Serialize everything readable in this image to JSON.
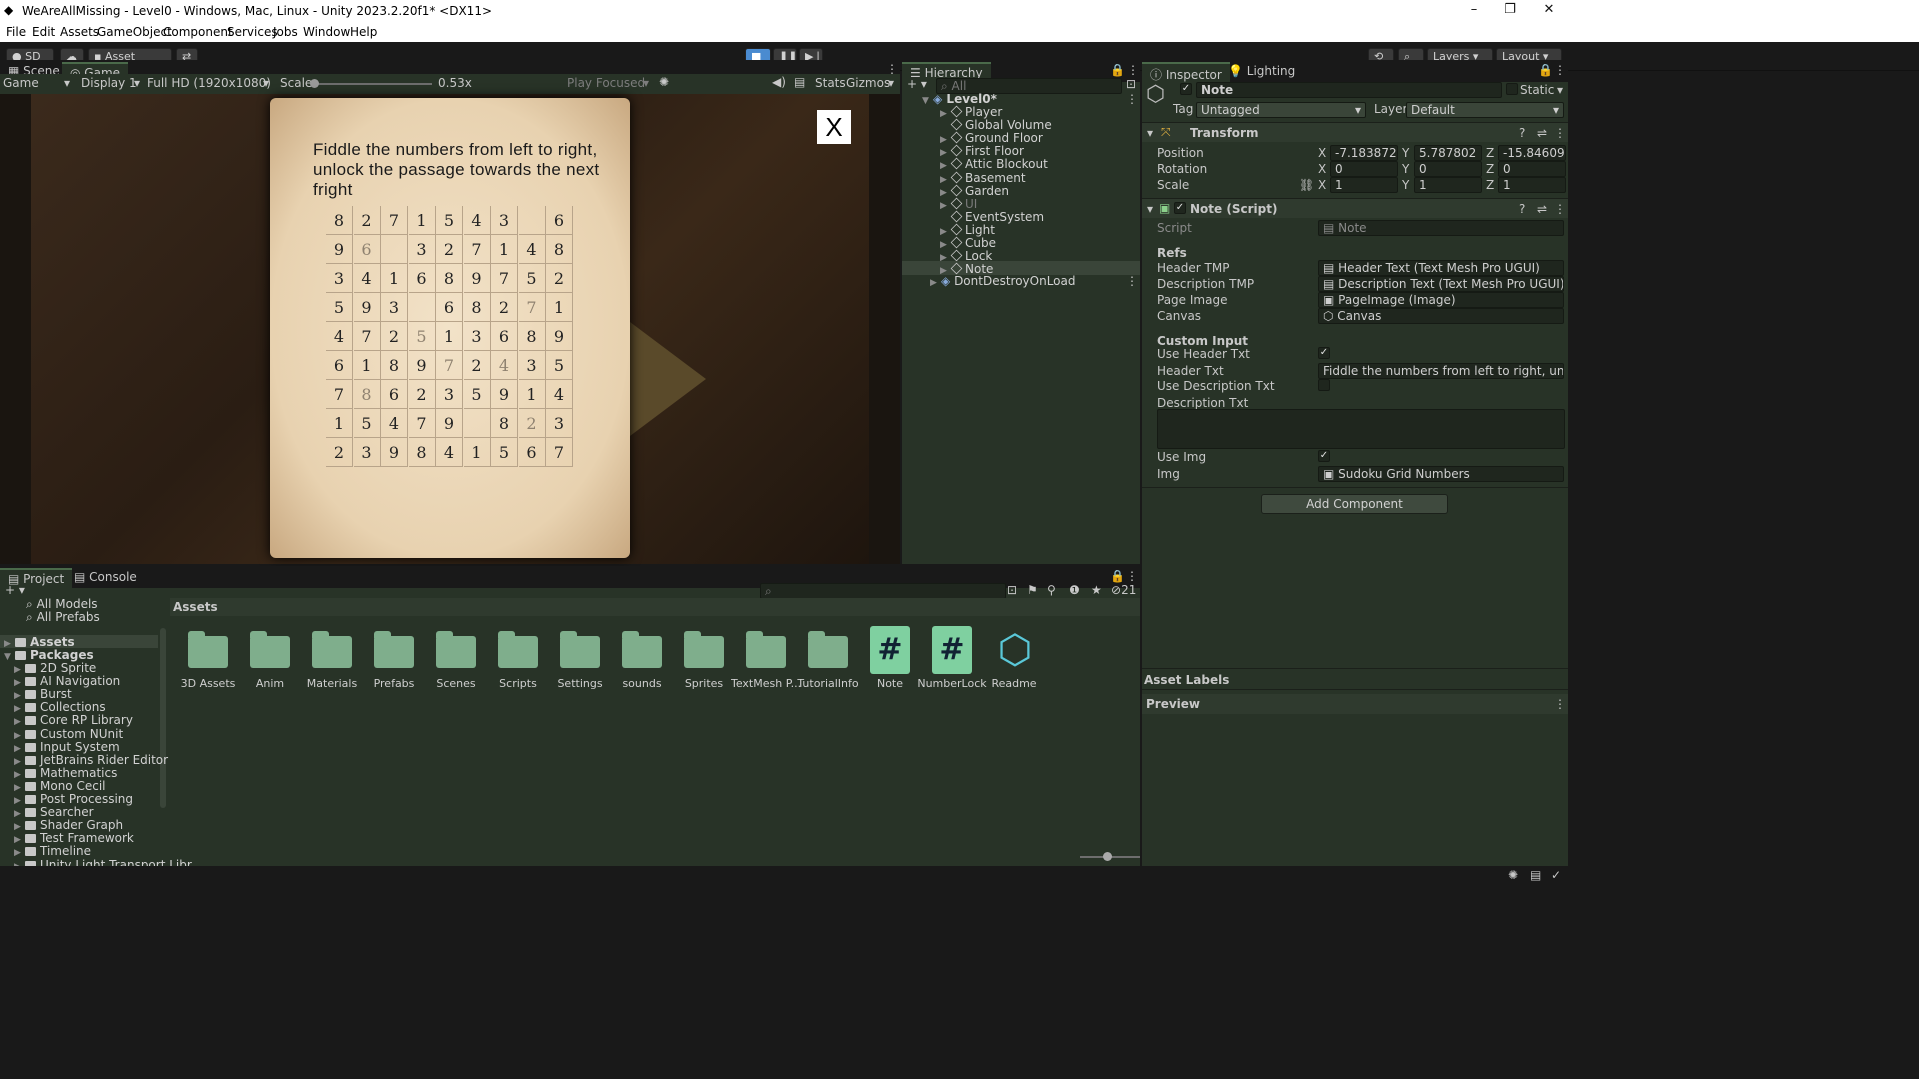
{
  "window": {
    "title": "WeAreAllMissing - Level0 - Windows, Mac, Linux - Unity 2023.2.20f1* <DX11>",
    "controls": [
      "–",
      "❐",
      "✕"
    ]
  },
  "menu": [
    "File",
    "Edit",
    "Assets",
    "GameObject",
    "Component",
    "Services",
    "Jobs",
    "Window",
    "Help"
  ],
  "toolbar": {
    "account": "SD",
    "asset_store": "Asset Store",
    "layers": "Layers",
    "layout": "Layout"
  },
  "scene_tabs": {
    "scene": "Scene",
    "game": "Game"
  },
  "game_bar": {
    "mode": "Game",
    "display": "Display 1",
    "resolution": "Full HD (1920x1080)",
    "scale_label": "Scale",
    "scale_value": "0.53x",
    "play_focused": "Play Focused",
    "stats": "Stats",
    "gizmos": "Gizmos"
  },
  "game_view": {
    "note_text": "Fiddle the numbers from left to right, unlock the passage towards the next fright",
    "close_label": "X",
    "grid": [
      [
        "8",
        "2",
        "7",
        "1",
        "5",
        "4",
        "3",
        "",
        "6"
      ],
      [
        "9",
        "6",
        "",
        "3",
        "2",
        "7",
        "1",
        "4",
        "8"
      ],
      [
        "3",
        "4",
        "1",
        "6",
        "8",
        "9",
        "7",
        "5",
        "2"
      ],
      [
        "5",
        "9",
        "3",
        "",
        "6",
        "8",
        "2",
        "7",
        "1"
      ],
      [
        "4",
        "7",
        "2",
        "5",
        "1",
        "3",
        "6",
        "8",
        "9"
      ],
      [
        "6",
        "1",
        "8",
        "9",
        "7",
        "2",
        "4",
        "3",
        "5"
      ],
      [
        "7",
        "8",
        "6",
        "2",
        "3",
        "5",
        "9",
        "1",
        "4"
      ],
      [
        "1",
        "5",
        "4",
        "7",
        "9",
        "",
        "8",
        "2",
        "3"
      ],
      [
        "2",
        "3",
        "9",
        "8",
        "4",
        "1",
        "5",
        "6",
        "7"
      ]
    ],
    "light_cells": [
      "1-1",
      "3-7",
      "4-3",
      "5-4",
      "5-6",
      "6-1",
      "7-7"
    ]
  },
  "hierarchy": {
    "tab": "Hierarchy",
    "search_placeholder": "All",
    "scene": "Level0*",
    "items": [
      "Player",
      "Global Volume",
      "Ground Floor",
      "First Floor",
      "Attic Blockout",
      "Basement",
      "Garden",
      "UI",
      "EventSystem",
      "Light",
      "Cube",
      "Lock",
      "Note"
    ],
    "dont_destroy": "DontDestroyOnLoad"
  },
  "inspector": {
    "tab": "Inspector",
    "lighting_tab": "Lighting",
    "object_name": "Note",
    "static_label": "Static",
    "tag_label": "Tag",
    "tag_value": "Untagged",
    "layer_label": "Layer",
    "layer_value": "Default",
    "transform": {
      "title": "Transform",
      "position_label": "Position",
      "rotation_label": "Rotation",
      "scale_label": "Scale",
      "position": {
        "x": "-7.183872",
        "y": "5.787802",
        "z": "-15.84609"
      },
      "rotation": {
        "x": "0",
        "y": "0",
        "z": "0"
      },
      "scale": {
        "x": "1",
        "y": "1",
        "z": "1"
      }
    },
    "script_comp": {
      "title": "Note (Script)",
      "script_label": "Script",
      "script_value": "Note",
      "refs_header": "Refs",
      "header_tmp_label": "Header TMP",
      "header_tmp_value": "Header Text (Text Mesh Pro UGUI)",
      "desc_tmp_label": "Description TMP",
      "desc_tmp_value": "Description Text (Text Mesh Pro UGUI)",
      "page_image_label": "Page Image",
      "page_image_value": "PageImage (Image)",
      "canvas_label": "Canvas",
      "canvas_value": "Canvas",
      "custom_header": "Custom Input",
      "use_header_label": "Use Header Txt",
      "header_txt_label": "Header Txt",
      "header_txt_value": "Fiddle the numbers from left to right, unlock the pas",
      "use_desc_label": "Use Description Txt",
      "desc_txt_label": "Description Txt",
      "use_img_label": "Use Img",
      "img_label": "Img",
      "img_value": "Sudoku Grid Numbers"
    },
    "add_component": "Add Component",
    "asset_labels": "Asset Labels",
    "preview": "Preview"
  },
  "project": {
    "tab": "Project",
    "console_tab": "Console",
    "hidden_count": "21",
    "breadcrumb": "Assets",
    "favorites": [
      "All Models",
      "All Prefabs"
    ],
    "assets_root": "Assets",
    "packages_root": "Packages",
    "packages": [
      "2D Sprite",
      "AI Navigation",
      "Burst",
      "Collections",
      "Core RP Library",
      "Custom NUnit",
      "Input System",
      "JetBrains Rider Editor",
      "Mathematics",
      "Mono Cecil",
      "Post Processing",
      "Searcher",
      "Shader Graph",
      "Test Framework",
      "Timeline",
      "Unity Light Transport Libr..."
    ],
    "assets": [
      {
        "name": "3D Assets",
        "kind": "folder"
      },
      {
        "name": "Anim",
        "kind": "folder"
      },
      {
        "name": "Materials",
        "kind": "folder"
      },
      {
        "name": "Prefabs",
        "kind": "folder"
      },
      {
        "name": "Scenes",
        "kind": "folder"
      },
      {
        "name": "Scripts",
        "kind": "folder"
      },
      {
        "name": "Settings",
        "kind": "folder"
      },
      {
        "name": "sounds",
        "kind": "folder"
      },
      {
        "name": "Sprites",
        "kind": "folder"
      },
      {
        "name": "TextMesh P...",
        "kind": "folder"
      },
      {
        "name": "TutorialInfo",
        "kind": "folder"
      },
      {
        "name": "Note",
        "kind": "script"
      },
      {
        "name": "NumberLock",
        "kind": "script"
      },
      {
        "name": "Readme",
        "kind": "readme"
      }
    ]
  }
}
